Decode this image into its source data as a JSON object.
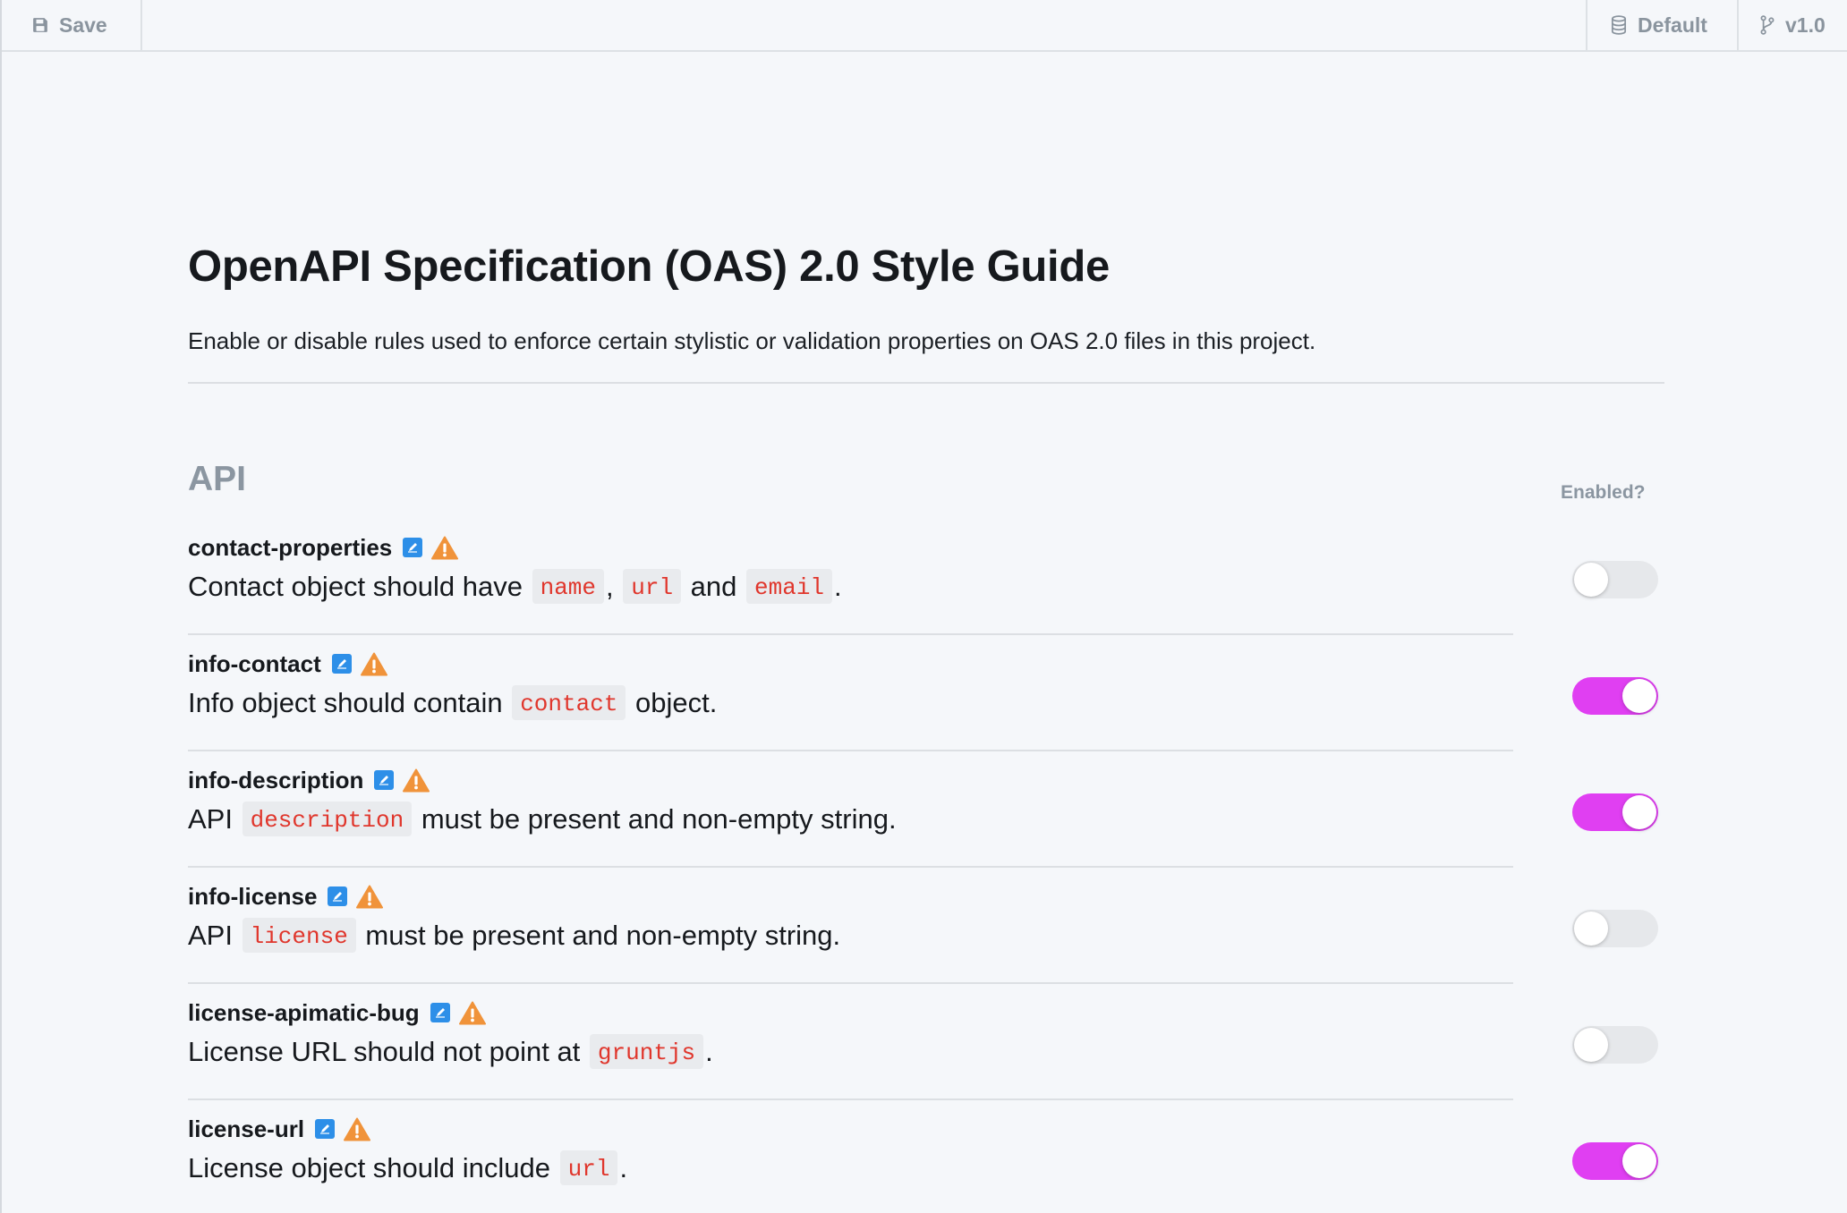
{
  "toolbar": {
    "save_label": "Save",
    "default_label": "Default",
    "version_label": "v1.0"
  },
  "page": {
    "title": "OpenAPI Specification (OAS) 2.0 Style Guide",
    "subtitle": "Enable or disable rules used to enforce certain stylistic or validation properties on OAS 2.0 files in this project."
  },
  "section": {
    "title": "API",
    "enabled_header": "Enabled?"
  },
  "colors": {
    "toggle_on": "#e03ff2",
    "code_text": "#e0362c",
    "edit_icon": "#2d8fe8",
    "warn_icon": "#f0933a"
  },
  "rules": [
    {
      "name": "contact-properties",
      "enabled": false,
      "description": [
        {
          "t": "text",
          "v": "Contact object should have "
        },
        {
          "t": "code",
          "v": "name"
        },
        {
          "t": "text",
          "v": ", "
        },
        {
          "t": "code",
          "v": "url"
        },
        {
          "t": "text",
          "v": " and "
        },
        {
          "t": "code",
          "v": "email"
        },
        {
          "t": "text",
          "v": "."
        }
      ]
    },
    {
      "name": "info-contact",
      "enabled": true,
      "description": [
        {
          "t": "text",
          "v": "Info object should contain "
        },
        {
          "t": "code",
          "v": "contact"
        },
        {
          "t": "text",
          "v": " object."
        }
      ]
    },
    {
      "name": "info-description",
      "enabled": true,
      "description": [
        {
          "t": "text",
          "v": "API "
        },
        {
          "t": "code",
          "v": "description"
        },
        {
          "t": "text",
          "v": " must be present and non-empty string."
        }
      ]
    },
    {
      "name": "info-license",
      "enabled": false,
      "description": [
        {
          "t": "text",
          "v": "API "
        },
        {
          "t": "code",
          "v": "license"
        },
        {
          "t": "text",
          "v": " must be present and non-empty string."
        }
      ]
    },
    {
      "name": "license-apimatic-bug",
      "enabled": false,
      "description": [
        {
          "t": "text",
          "v": "License URL should not point at "
        },
        {
          "t": "code",
          "v": "gruntjs"
        },
        {
          "t": "text",
          "v": "."
        }
      ]
    },
    {
      "name": "license-url",
      "enabled": true,
      "description": [
        {
          "t": "text",
          "v": "License object should include "
        },
        {
          "t": "code",
          "v": "url"
        },
        {
          "t": "text",
          "v": "."
        }
      ]
    }
  ]
}
